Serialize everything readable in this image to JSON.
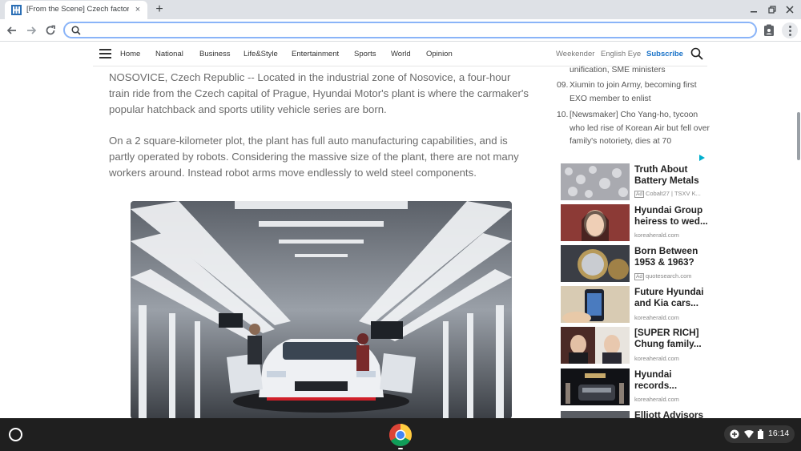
{
  "browser": {
    "tab_title": "[From the Scene] Czech factory c",
    "new_tab": "+",
    "tab_close": "×",
    "omnibox_value": "",
    "accent": "#8ab4f8"
  },
  "site_nav": {
    "items": [
      "Home",
      "National",
      "Business",
      "Life&Style",
      "Entertainment",
      "Sports",
      "World",
      "Opinion"
    ],
    "right_links": [
      "Weekender",
      "English Eye"
    ],
    "subscribe": "Subscribe",
    "subscribe_color": "#1a73c8"
  },
  "article": {
    "paragraphs": [
      "NOSOVICE, Czech Republic -- Located in the industrial zone of Nosovice, a four-hour train ride from the Czech capital of Prague, Hyundai Motor's plant is where the carmaker's popular hatchback and sports utility vehicle series are born.",
      "On a 2 square-kilometer plot, the plant has full auto manufacturing capabilities, and is partly operated by robots. Considering the massive size of the plant, there are not many workers around. Instead robot arms move endlessly to weld steel components."
    ],
    "photo_icon": "factory-production-line-photo"
  },
  "sidebar": {
    "popular": [
      {
        "num": "",
        "text": "unification, SME ministers"
      },
      {
        "num": "09.",
        "text": "Xiumin to join Army, becoming first EXO member to enlist"
      },
      {
        "num": "10.",
        "text": "[Newsmaker] Cho Yang-ho, tycoon who led rise of Korean Air but fell over family's notoriety, dies at 70"
      }
    ],
    "ads": [
      {
        "title": "Truth About Battery Metals",
        "badge": "Ad",
        "source": "Cobalt27 | TSXV K..."
      },
      {
        "title": "Hyundai Group heiress to wed...",
        "badge": "",
        "source": "koreaherald.com"
      },
      {
        "title": "Born Between 1953 & 1963?",
        "badge": "Ad",
        "source": "quotesearch.com"
      },
      {
        "title": "Future Hyundai and Kia cars...",
        "badge": "",
        "source": "koreaherald.com"
      },
      {
        "title": "[SUPER RICH] Chung family...",
        "badge": "",
        "source": "koreaherald.com"
      },
      {
        "title": "Hyundai records...",
        "badge": "",
        "source": "koreaherald.com"
      },
      {
        "title": "Elliott Advisors",
        "badge": "",
        "source": ""
      }
    ]
  },
  "system": {
    "clock": "16:14"
  }
}
